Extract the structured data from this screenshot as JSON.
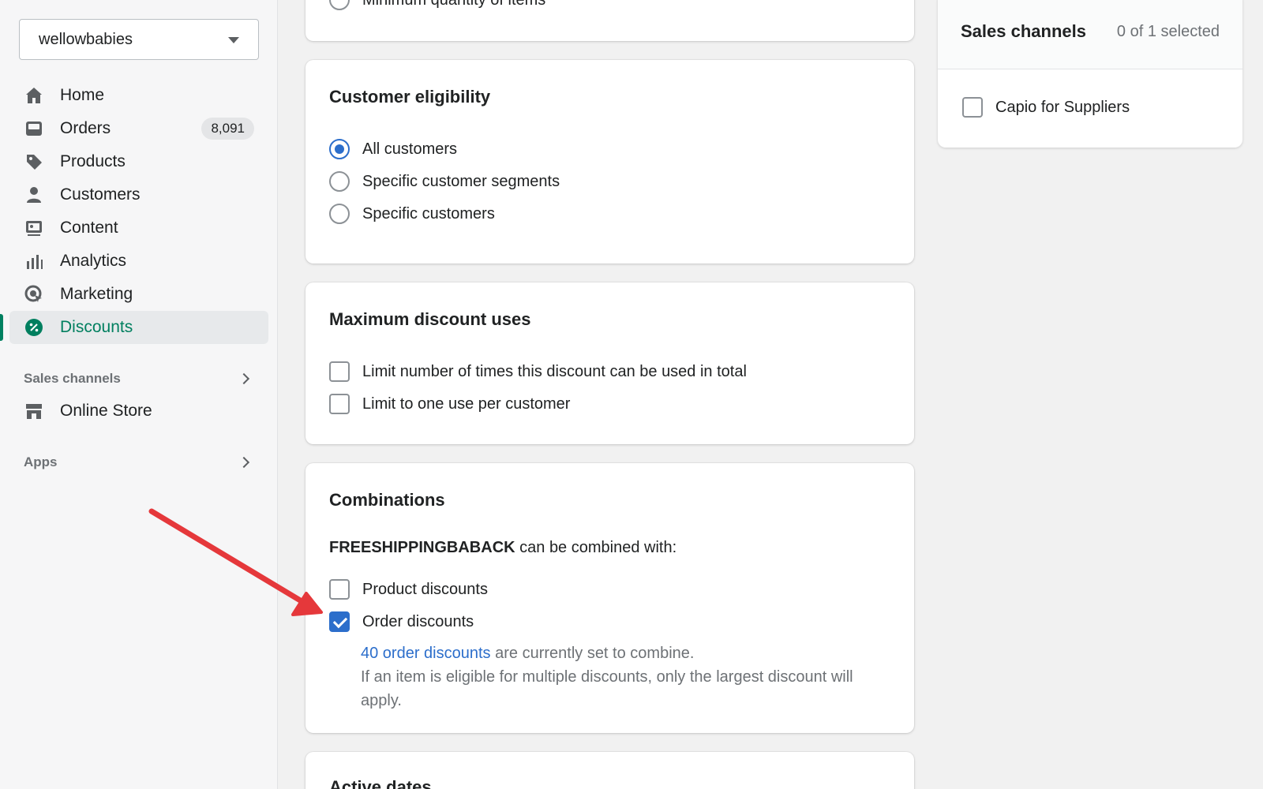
{
  "store": {
    "name": "wellowbabies"
  },
  "nav": {
    "items": [
      {
        "label": "Home",
        "icon": "home-icon"
      },
      {
        "label": "Orders",
        "icon": "orders-icon",
        "badge": "8,091"
      },
      {
        "label": "Products",
        "icon": "tag-icon"
      },
      {
        "label": "Customers",
        "icon": "person-icon"
      },
      {
        "label": "Content",
        "icon": "content-icon"
      },
      {
        "label": "Analytics",
        "icon": "analytics-icon"
      },
      {
        "label": "Marketing",
        "icon": "marketing-icon"
      },
      {
        "label": "Discounts",
        "icon": "discount-icon",
        "active": true
      }
    ],
    "sales_channels_label": "Sales channels",
    "online_store_label": "Online Store",
    "apps_label": "Apps"
  },
  "min_req": {
    "partial_option": "Minimum quantity of items"
  },
  "eligibility": {
    "title": "Customer eligibility",
    "options": [
      "All customers",
      "Specific customer segments",
      "Specific customers"
    ],
    "selected": "All customers"
  },
  "max_uses": {
    "title": "Maximum discount uses",
    "options": [
      "Limit number of times this discount can be used in total",
      "Limit to one use per customer"
    ]
  },
  "combinations": {
    "title": "Combinations",
    "code": "FREESHIPPINGBABACK",
    "intro_suffix": " can be combined with:",
    "product_label": "Product discounts",
    "order_label": "Order discounts",
    "order_checked": true,
    "link_text": "40 order discounts",
    "link_suffix": " are currently set to combine.",
    "note": "If an item is eligible for multiple discounts, only the largest discount will apply."
  },
  "active_dates": {
    "title": "Active dates"
  },
  "sales_channels": {
    "title": "Sales channels",
    "count": "0 of 1 selected",
    "channel": "Capio for Suppliers"
  },
  "colors": {
    "accent": "#2c6ecb",
    "active_nav": "#007f5f",
    "annotation_arrow": "#e5383b"
  }
}
